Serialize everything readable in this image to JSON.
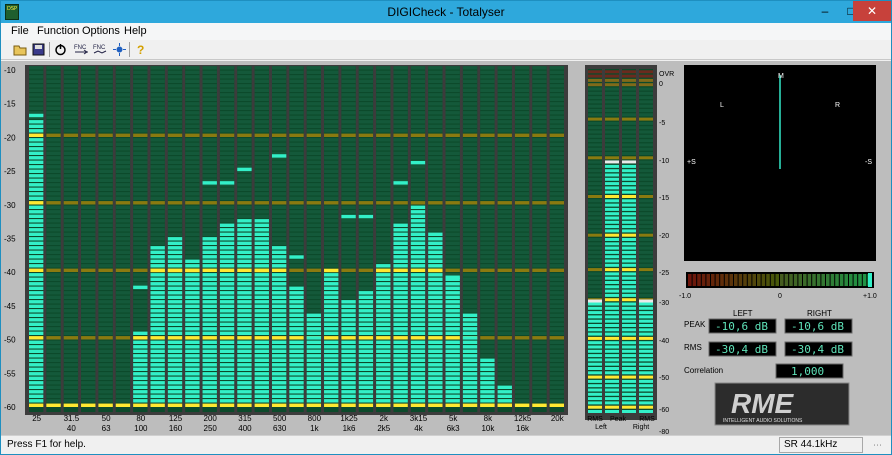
{
  "window": {
    "title": "DIGICheck - Totalyser",
    "app_icon_text": "DSP"
  },
  "menu": [
    "File",
    "Function",
    "Options",
    "Help"
  ],
  "toolbar": {
    "items": [
      "open-icon",
      "save-icon",
      "power-icon",
      "fnc-icon",
      "fnc-alt-icon",
      "reset-icon",
      "settings-icon",
      "help-icon"
    ],
    "labels": {
      "fnc1": "FNC",
      "fnc2": "FNC"
    }
  },
  "colors": {
    "meter_bg": "#0c4a2b",
    "meter_bar": "#33f0c8",
    "peak_hold": "#ffe832",
    "grid_line": "#8a7a10",
    "panel": "#bdbdbd",
    "vector_bg": "#000000",
    "lcd_bg": "#000000",
    "lcd_text": "#5fe3b9"
  },
  "spectrum": {
    "y_axis_labels": [
      "-10",
      "-15",
      "-20",
      "-25",
      "-30",
      "-35",
      "-40",
      "-45",
      "-50",
      "-55",
      "-60"
    ],
    "bands_top_row": [
      "25",
      "31.5",
      "50",
      "80",
      "125",
      "200",
      "315",
      "500",
      "800",
      "1k25",
      "2k",
      "3k15",
      "5k",
      "8k",
      "12k5",
      "20k"
    ],
    "bands_bottom_row": [
      "40",
      "63",
      "100",
      "160",
      "250",
      "400",
      "630",
      "1k",
      "1k6",
      "2k5",
      "4k",
      "6k3",
      "10k",
      "16k"
    ],
    "levels_db": [
      -17.5,
      -61,
      -61,
      -61,
      -61,
      -61,
      -49,
      -36,
      -35,
      -38,
      -35,
      -33,
      -32,
      -32,
      -36,
      -42,
      -46,
      -40,
      -44,
      -43,
      -39,
      -33,
      -30,
      -34,
      -41,
      -46,
      -53,
      -57,
      -61,
      -61,
      -61
    ],
    "peak_holds_db": [
      -17,
      -60,
      -60,
      -60,
      -60,
      -60,
      -42.5,
      -40,
      -40,
      -40,
      -27,
      -27,
      -25,
      -40,
      -23,
      -38,
      -50,
      -40,
      -32,
      -32,
      -40,
      -27,
      -24,
      -40,
      -41,
      -50,
      -60,
      -60,
      -60,
      -60,
      -60
    ]
  },
  "level_meter": {
    "scale_labels": [
      "OVR",
      "0",
      "-5",
      "-10",
      "-15",
      "-20",
      "-25",
      "-30",
      "-40",
      "-50",
      "-60",
      "-80"
    ],
    "channels": [
      {
        "label_top": "RMS",
        "label_bottom": "Left",
        "level_db": -30.4
      },
      {
        "label_top": "Peak",
        "label_bottom": "Peak",
        "level_db": -10.6
      },
      {
        "label_top": "Peak",
        "label_bottom": "",
        "level_db": -10.6
      },
      {
        "label_top": "RMS",
        "label_bottom": "Right",
        "level_db": -30.4
      }
    ],
    "bottom_labels": [
      "RMS",
      "Peak",
      "RMS"
    ],
    "bottom_sub_labels": [
      "Left",
      "Right"
    ]
  },
  "vectorscope": {
    "labels": {
      "m": "M",
      "l": "L",
      "r": "R",
      "plus_s": "+S",
      "minus_s": "-S"
    }
  },
  "correlation_meter": {
    "min_label": "-1.0",
    "mid_label": "0",
    "max_label": "+1.0",
    "value": 1.0
  },
  "readouts": {
    "left_header": "LEFT",
    "right_header": "RIGHT",
    "peak_label": "PEAK",
    "rms_label": "RMS",
    "peak_left": "-10,6 dB",
    "peak_right": "-10,6 dB",
    "rms_left": "-30,4 dB",
    "rms_right": "-30,4 dB",
    "correlation_label": "Correlation",
    "correlation_value": "1,000"
  },
  "logo": {
    "text": "RME",
    "subtitle": "INTELLIGENT AUDIO SOLUTIONS"
  },
  "status": {
    "help": "Press F1 for help.",
    "sample_rate": "SR 44.1kHz"
  }
}
